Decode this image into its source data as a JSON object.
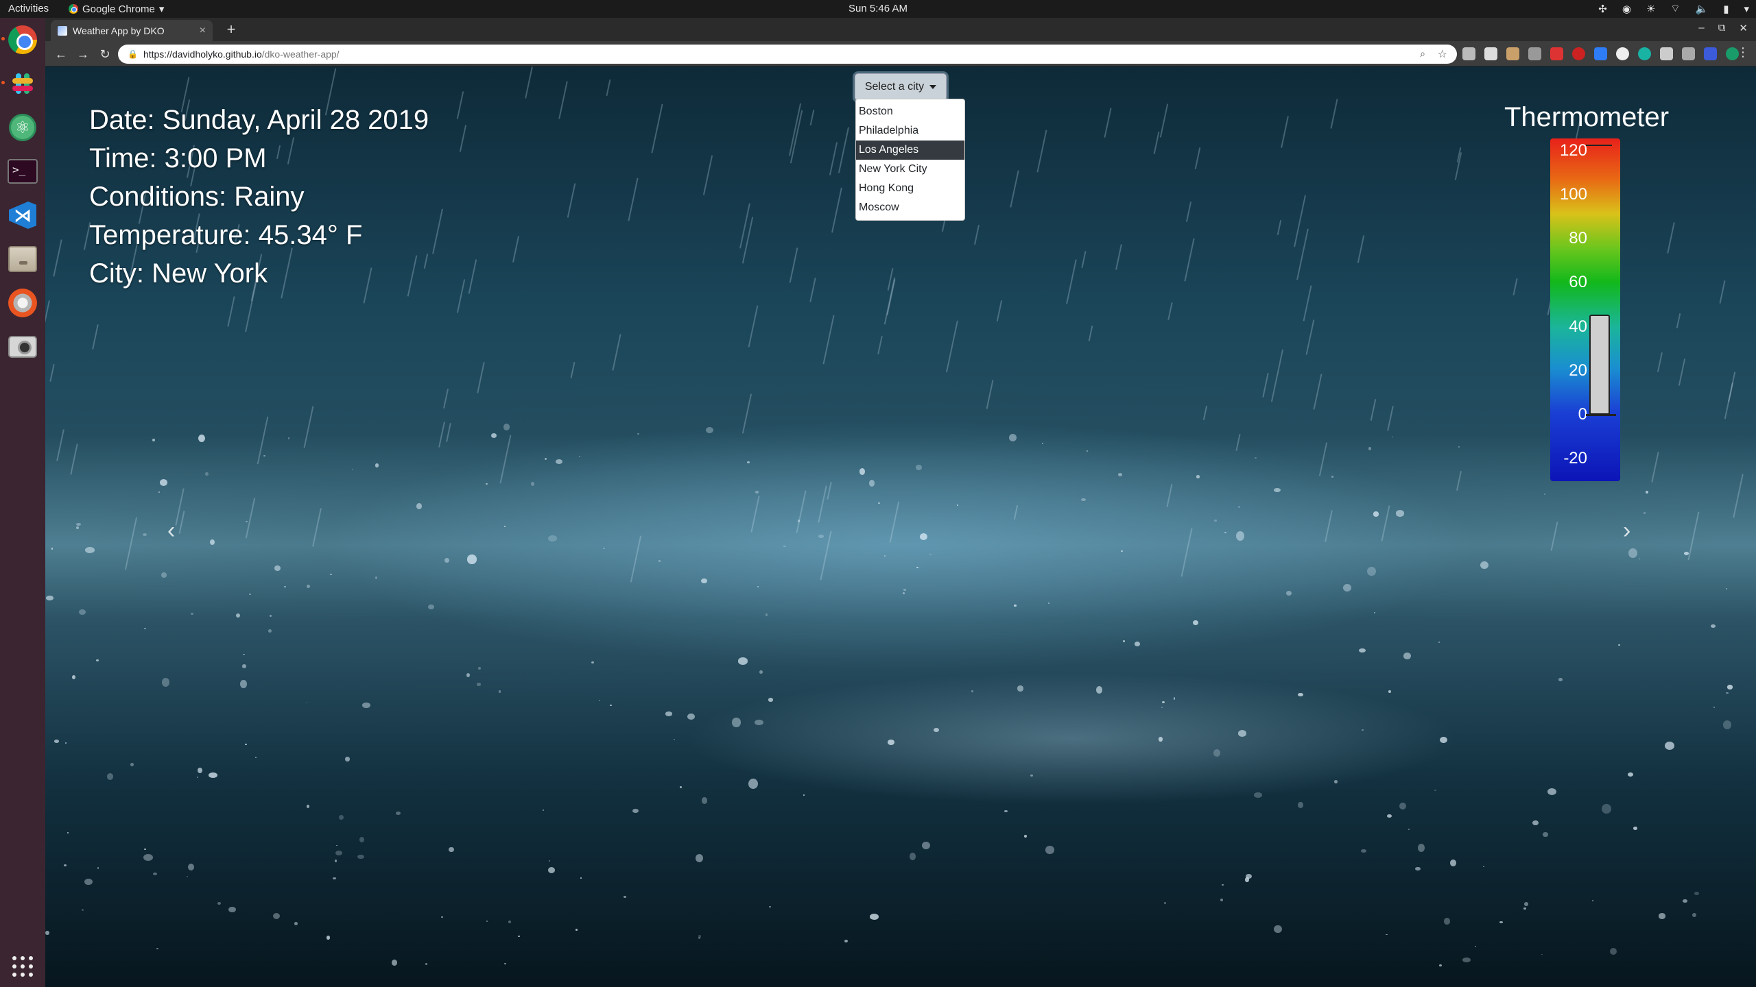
{
  "os": {
    "activities": "Activities",
    "app_menu": "Google Chrome",
    "clock": "Sun  5:46 AM"
  },
  "browser": {
    "tab_title": "Weather App by DKO",
    "url_host": "https://davidholyko.github.io",
    "url_path": "/dko-weather-app/"
  },
  "weather": {
    "date": "Date: Sunday, April 28 2019",
    "time": "Time: 3:00 PM",
    "conditions": "Conditions: Rainy",
    "temperature": "Temperature: 45.34° F",
    "city": "City: New York"
  },
  "city_select": {
    "label": "Select a city",
    "options": [
      "Boston",
      "Philadelphia",
      "Los Angeles",
      "New York City",
      "Hong Kong",
      "Moscow"
    ],
    "highlighted": "Los Angeles"
  },
  "thermometer": {
    "title": "Thermometer",
    "ticks": [
      "120",
      "100",
      "80",
      "60",
      "40",
      "20",
      "0",
      "-20"
    ],
    "value_f": 45.34,
    "scale_min": -20,
    "scale_max": 120
  },
  "icons": {
    "dock": [
      "chrome-icon",
      "slack-icon",
      "atom-icon",
      "terminal-icon",
      "vscode-icon",
      "files-icon",
      "settings-icon",
      "camera-icon",
      "app-grid-icon"
    ],
    "carousel_prev": "‹",
    "carousel_next": "›"
  }
}
